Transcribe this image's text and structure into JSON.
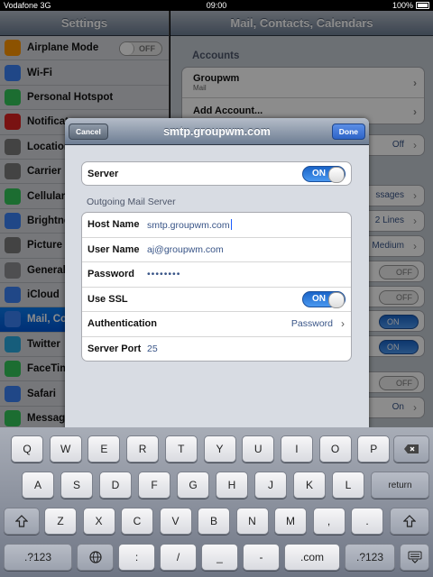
{
  "status": {
    "carrier": "Vodafone 3G",
    "time": "09:00",
    "battery": "100%"
  },
  "left_pane": {
    "title": "Settings",
    "items": [
      {
        "label": "Airplane Mode",
        "toggle": "OFF",
        "icon": "airplane-icon",
        "color": "#ff9500"
      },
      {
        "label": "Wi-Fi",
        "icon": "wifi-icon",
        "color": "#3b82f6"
      },
      {
        "label": "Personal Hotspot",
        "icon": "hotspot-icon",
        "color": "#34c759"
      },
      {
        "label": "Notificat",
        "icon": "notifications-icon",
        "color": "#d22"
      },
      {
        "label": "Location",
        "icon": "location-icon",
        "color": "#7a7a7a"
      },
      {
        "label": "Carrier",
        "icon": "carrier-icon",
        "color": "#7a7a7a"
      },
      {
        "label": "Cellular",
        "icon": "cellular-icon",
        "color": "#34c759"
      },
      {
        "label": "Brightne",
        "icon": "brightness-icon",
        "color": "#3b82f6"
      },
      {
        "label": "Picture F",
        "icon": "picture-frame-icon",
        "color": "#7a7a7a"
      },
      {
        "label": "General",
        "icon": "general-icon",
        "color": "#8e8e93"
      },
      {
        "label": "iCloud",
        "icon": "icloud-icon",
        "color": "#3b82f6"
      },
      {
        "label": "Mail, Co",
        "icon": "mail-icon",
        "color": "#3b82f6"
      },
      {
        "label": "Twitter",
        "icon": "twitter-icon",
        "color": "#29a9e0"
      },
      {
        "label": "FaceTim",
        "icon": "facetime-icon",
        "color": "#34c759"
      },
      {
        "label": "Safari",
        "icon": "safari-icon",
        "color": "#3b82f6"
      },
      {
        "label": "Message",
        "icon": "messages-icon",
        "color": "#34c759"
      }
    ]
  },
  "right_pane": {
    "title": "Mail, Contacts, Calendars",
    "accounts_label": "Accounts",
    "account_name": "Groupwm",
    "account_sub": "Mail",
    "add_account": "Add Account...",
    "values": [
      "Off",
      "ssages",
      "2 Lines",
      "Medium"
    ],
    "toggles": [
      "OFF",
      "OFF",
      "ON",
      "ON",
      "OFF"
    ],
    "last_value": "On"
  },
  "sheet": {
    "title": "smtp.groupwm.com",
    "cancel_label": "Cancel",
    "done_label": "Done",
    "server_label": "Server",
    "server_toggle": "ON",
    "section_header": "Outgoing Mail Server",
    "host_name_label": "Host Name",
    "host_name_value": "smtp.groupwm.com",
    "user_name_label": "User Name",
    "user_name_value": "aj@groupwm.com",
    "password_label": "Password",
    "password_value": "••••••••",
    "use_ssl_label": "Use SSL",
    "use_ssl_toggle": "ON",
    "authentication_label": "Authentication",
    "authentication_value": "Password",
    "server_port_label": "Server Port",
    "server_port_value": "25"
  },
  "keyboard": {
    "row1": [
      "Q",
      "W",
      "E",
      "R",
      "T",
      "Y",
      "U",
      "I",
      "O",
      "P"
    ],
    "row2": [
      "A",
      "S",
      "D",
      "F",
      "G",
      "H",
      "J",
      "K",
      "L"
    ],
    "row3": [
      "Z",
      "X",
      "C",
      "V",
      "B",
      "N",
      "M",
      ",",
      "."
    ],
    "return_label": "return",
    "numbers_label": ".?123",
    "colon": ":",
    "slash": "/",
    "underscore": "_",
    "dash": "-",
    "dotcom": ".com"
  }
}
